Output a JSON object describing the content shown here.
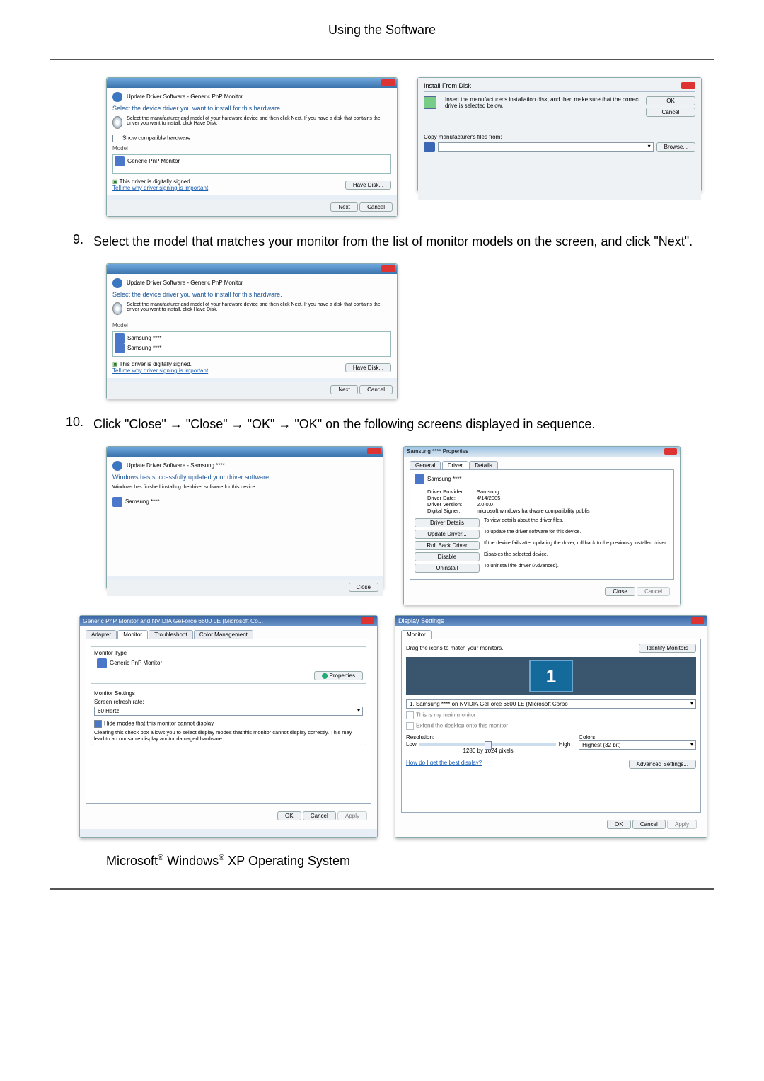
{
  "header": "Using the Software",
  "step9": {
    "num": "9.",
    "text": "Select the model that matches your monitor from the list of monitor models on the screen, and click \"Next\"."
  },
  "step10": {
    "num": "10.",
    "text": "Click \"Close\" → \"Close\" → \"OK\" → \"OK\" on the following screens displayed in sequence."
  },
  "final_pre": "Microsoft",
  "final_mid": " Windows",
  "final_post": " XP Operating System",
  "winA": {
    "title": "Update Driver Software - Generic PnP Monitor",
    "head": "Select the device driver you want to install for this hardware.",
    "sub": "Select the manufacturer and model of your hardware device and then click Next. If you have a disk that contains the driver you want to install, click Have Disk.",
    "compat": "Show compatible hardware",
    "modelhdr": "Model",
    "model1": "Generic PnP Monitor",
    "signed": "This driver is digitally signed.",
    "why": "Tell me why driver signing is important",
    "havedisk": "Have Disk...",
    "next": "Next",
    "cancel": "Cancel"
  },
  "winB": {
    "title": "Install From Disk",
    "msg": "Insert the manufacturer's installation disk, and then make sure that the correct drive is selected below.",
    "ok": "OK",
    "cancel": "Cancel",
    "copy": "Copy manufacturer's files from:",
    "browse": "Browse..."
  },
  "winC": {
    "title": "Update Driver Software - Generic PnP Monitor",
    "head": "Select the device driver you want to install for this hardware.",
    "sub": "Select the manufacturer and model of your hardware device and then click Next. If you have a disk that contains the driver you want to install, click Have Disk.",
    "modelhdr": "Model",
    "m1": "Samsung ****",
    "m2": "Samsung ****",
    "signed": "This driver is digitally signed.",
    "why": "Tell me why driver signing is important",
    "havedisk": "Have Disk...",
    "next": "Next",
    "cancel": "Cancel"
  },
  "winD": {
    "title": "Update Driver Software - Samsung ****",
    "head": "Windows has successfully updated your driver software",
    "sub": "Windows has finished installing the driver software for this device:",
    "dev": "Samsung ****",
    "close": "Close"
  },
  "winE": {
    "title": "Samsung **** Properties",
    "tabs": [
      "General",
      "Driver",
      "Details"
    ],
    "dev": "Samsung ****",
    "rows": {
      "provider_l": "Driver Provider:",
      "provider_v": "Samsung",
      "date_l": "Driver Date:",
      "date_v": "4/14/2005",
      "ver_l": "Driver Version:",
      "ver_v": "2.0.0.0",
      "sign_l": "Digital Signer:",
      "sign_v": "microsoft windows hardware compatibility publis"
    },
    "btns": {
      "details": "Driver Details",
      "details_t": "To view details about the driver files.",
      "update": "Update Driver...",
      "update_t": "To update the driver software for this device.",
      "roll": "Roll Back Driver",
      "roll_t": "If the device fails after updating the driver, roll back to the previously installed driver.",
      "disable": "Disable",
      "disable_t": "Disables the selected device.",
      "uninstall": "Uninstall",
      "uninstall_t": "To uninstall the driver (Advanced)."
    },
    "close": "Close",
    "cancel": "Cancel"
  },
  "winF": {
    "title": "Generic PnP Monitor and NVIDIA GeForce 6600 LE (Microsoft Co...",
    "tabs": [
      "Adapter",
      "Monitor",
      "Troubleshoot",
      "Color Management"
    ],
    "mtype": "Monitor Type",
    "mname": "Generic PnP Monitor",
    "props": "Properties",
    "mset": "Monitor Settings",
    "refresh": "Screen refresh rate:",
    "hz": "60 Hertz",
    "hide": "Hide modes that this monitor cannot display",
    "hidetxt": "Clearing this check box allows you to select display modes that this monitor cannot display correctly. This may lead to an unusable display and/or damaged hardware.",
    "ok": "OK",
    "cancel": "Cancel",
    "apply": "Apply"
  },
  "winG": {
    "title": "Display Settings",
    "tab": "Monitor",
    "drag": "Drag the icons to match your monitors.",
    "ident": "Identify Monitors",
    "sel": "1. Samsung **** on NVIDIA GeForce 6600 LE (Microsoft Corpo",
    "main": "This is my main monitor",
    "ext": "Extend the desktop onto this monitor",
    "res": "Resolution:",
    "low": "Low",
    "high": "High",
    "resval": "1280 by 1024 pixels",
    "col": "Colors:",
    "colval": "Highest (32 bit)",
    "best": "How do I get the best display?",
    "adv": "Advanced Settings...",
    "ok": "OK",
    "cancel": "Cancel",
    "apply": "Apply"
  }
}
